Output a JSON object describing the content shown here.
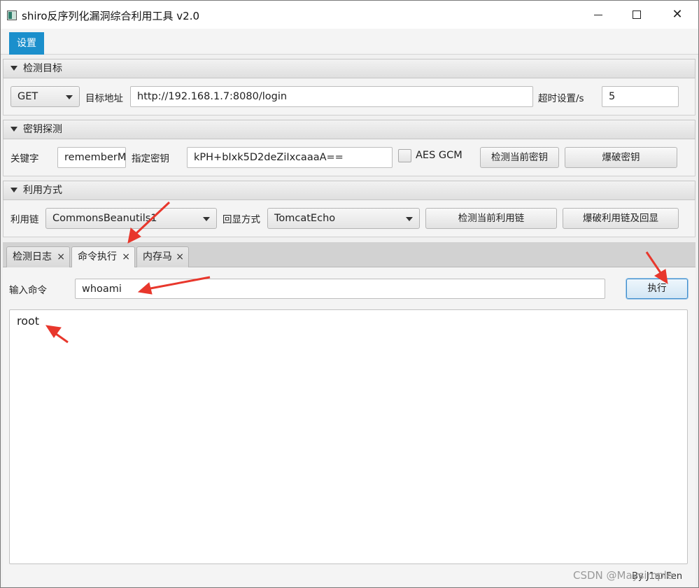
{
  "window": {
    "title": "shiro反序列化漏洞综合利用工具 v2.0",
    "controls": {
      "minimize": "—",
      "maximize": "☐",
      "close": "✕"
    }
  },
  "menubar": {
    "settings": "设置"
  },
  "detect_target": {
    "header": "检测目标",
    "method": "GET",
    "target_label": "目标地址",
    "target_url": "http://192.168.1.7:8080/login",
    "timeout_label": "超时设置/s",
    "timeout_value": "5"
  },
  "key_probe": {
    "header": "密钥探测",
    "keyword_label": "关键字",
    "keyword_value": "rememberMe",
    "key_label": "指定密钥",
    "key_value": "kPH+bIxk5D2deZiIxcaaaA==",
    "aes_gcm_label": "AES GCM",
    "aes_gcm_checked": false,
    "check_key_button": "检测当前密钥",
    "brute_key_button": "爆破密钥"
  },
  "exploit": {
    "header": "利用方式",
    "chain_label": "利用链",
    "chain_value": "CommonsBeanutils1",
    "echo_label": "回显方式",
    "echo_value": "TomcatEcho",
    "check_chain_button": "检测当前利用链",
    "brute_chain_button": "爆破利用链及回显"
  },
  "tabs": [
    {
      "label": "检测日志",
      "close": "×",
      "active": false
    },
    {
      "label": "命令执行",
      "close": "×",
      "active": true
    },
    {
      "label": "内存马",
      "close": "×",
      "active": false
    }
  ],
  "command": {
    "input_label": "输入命令",
    "input_value": "whoami",
    "execute_button": "执行",
    "output": "root"
  },
  "footer": {
    "watermark": "CSDN @Maysimple",
    "author": "By  J1anFen"
  },
  "colors": {
    "accent": "#1b8fcc",
    "annotation_arrow": "#e8372c"
  }
}
